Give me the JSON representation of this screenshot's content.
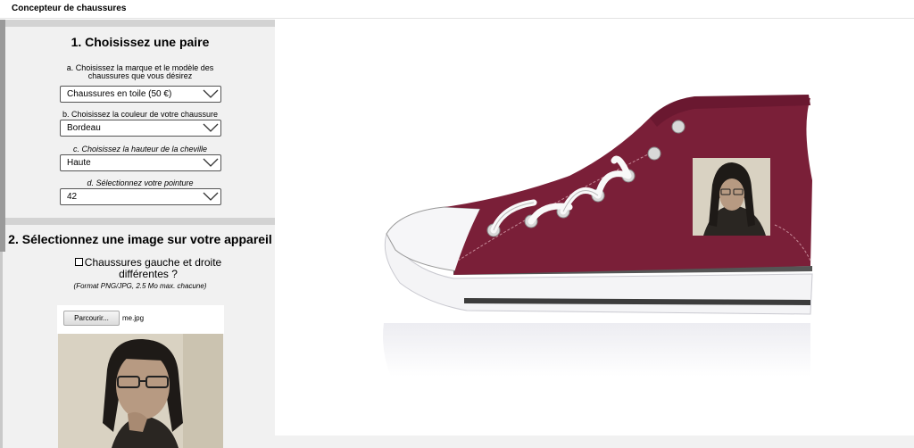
{
  "window": {
    "title": "Concepteur de chaussures"
  },
  "step1": {
    "heading": "1. Choisissez une paire",
    "brand_label_line1": "a. Choisissez la marque et le modèle des",
    "brand_label_line2": "chaussures que vous désirez",
    "brand_value": "Chaussures en toile (50 €)",
    "color_label": "b. Choisissez la couleur de votre chaussure",
    "color_value": "Bordeau",
    "height_label": "c. Choisissez la hauteur de la cheville",
    "height_value": "Haute",
    "size_label": "d. Sélectionnez votre pointure",
    "size_value": "42"
  },
  "step2": {
    "heading": "2. Sélectionnez une image sur votre appareil",
    "checkbox_line1": "Chaussures gauche et droite",
    "checkbox_line2": "différentes ?",
    "checkbox_checked": false,
    "format_note": "(Format PNG/JPG, 2.5 Mo max. chacune)",
    "browse_label": "Parcourir...",
    "file_name": "me.jpg"
  },
  "preview": {
    "shoe_color": "#7a1f38"
  }
}
